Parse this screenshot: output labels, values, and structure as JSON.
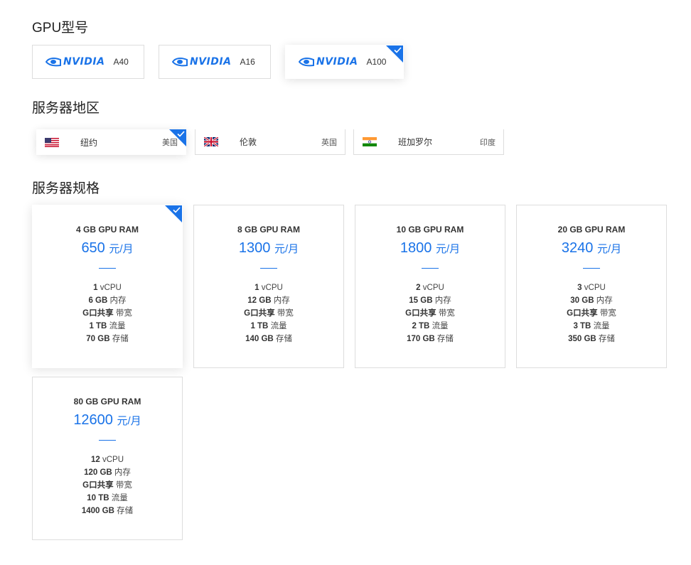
{
  "sections": {
    "gpu_model": "GPU型号",
    "region": "服务器地区",
    "spec": "服务器规格"
  },
  "brand": "NVIDIA",
  "accent_color": "#1a73e8",
  "gpu_options": [
    {
      "model": "A40",
      "selected": false
    },
    {
      "model": "A16",
      "selected": false
    },
    {
      "model": "A100",
      "selected": true
    }
  ],
  "regions": [
    {
      "city": "纽约",
      "country": "美国",
      "flag": "us-flag-icon",
      "selected": true
    },
    {
      "city": "伦敦",
      "country": "英国",
      "flag": "uk-flag-icon",
      "selected": false
    },
    {
      "city": "班加罗尔",
      "country": "印度",
      "flag": "india-flag-icon",
      "selected": false
    }
  ],
  "plans": [
    {
      "title": "4 GB GPU RAM",
      "price": "650",
      "unit": "元/月",
      "vcpu": "1",
      "vcpu_label": "vCPU",
      "ram": "6 GB",
      "ram_label": "内存",
      "bw": "G口共享",
      "bw_label": "带宽",
      "traffic": "1 TB",
      "traffic_label": "流量",
      "storage": "70 GB",
      "storage_label": "存储",
      "selected": true
    },
    {
      "title": "8 GB GPU RAM",
      "price": "1300",
      "unit": "元/月",
      "vcpu": "1",
      "vcpu_label": "vCPU",
      "ram": "12 GB",
      "ram_label": "内存",
      "bw": "G口共享",
      "bw_label": "带宽",
      "traffic": "1 TB",
      "traffic_label": "流量",
      "storage": "140 GB",
      "storage_label": "存储",
      "selected": false
    },
    {
      "title": "10 GB GPU RAM",
      "price": "1800",
      "unit": "元/月",
      "vcpu": "2",
      "vcpu_label": "vCPU",
      "ram": "15 GB",
      "ram_label": "内存",
      "bw": "G口共享",
      "bw_label": "带宽",
      "traffic": "2 TB",
      "traffic_label": "流量",
      "storage": "170 GB",
      "storage_label": "存储",
      "selected": false
    },
    {
      "title": "20 GB GPU RAM",
      "price": "3240",
      "unit": "元/月",
      "vcpu": "3",
      "vcpu_label": "vCPU",
      "ram": "30 GB",
      "ram_label": "内存",
      "bw": "G口共享",
      "bw_label": "带宽",
      "traffic": "3 TB",
      "traffic_label": "流量",
      "storage": "350 GB",
      "storage_label": "存储",
      "selected": false
    },
    {
      "title": "80 GB GPU RAM",
      "price": "12600",
      "unit": "元/月",
      "vcpu": "12",
      "vcpu_label": "vCPU",
      "ram": "120 GB",
      "ram_label": "内存",
      "bw": "G口共享",
      "bw_label": "带宽",
      "traffic": "10 TB",
      "traffic_label": "流量",
      "storage": "1400 GB",
      "storage_label": "存储",
      "selected": false
    }
  ]
}
